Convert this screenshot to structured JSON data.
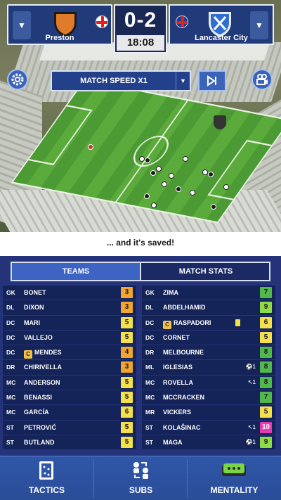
{
  "scoreboard": {
    "home_team": "Preston",
    "away_team": "Lancaster City",
    "score": "0-2",
    "clock": "18:08"
  },
  "controls": {
    "speed_label": "MATCH SPEED X1"
  },
  "commentary": "... and it's saved!",
  "tabs": {
    "teams": "TEAMS",
    "match_stats": "MATCH STATS"
  },
  "home_roster": [
    {
      "pos": "GK",
      "name": "BONET",
      "rating": "3"
    },
    {
      "pos": "DL",
      "name": "DIXON",
      "rating": "3"
    },
    {
      "pos": "DC",
      "name": "MARI",
      "rating": "5"
    },
    {
      "pos": "DC",
      "name": "VALLEJO",
      "rating": "5"
    },
    {
      "pos": "DC",
      "name": "MENDES",
      "rating": "4",
      "captain": "C"
    },
    {
      "pos": "DR",
      "name": "CHIRIVELLA",
      "rating": "3"
    },
    {
      "pos": "MC",
      "name": "ANDERSON",
      "rating": "5"
    },
    {
      "pos": "MC",
      "name": "BENASSI",
      "rating": "5"
    },
    {
      "pos": "MC",
      "name": "GARCÍA",
      "rating": "6"
    },
    {
      "pos": "ST",
      "name": "PETROVIĆ",
      "rating": "5"
    },
    {
      "pos": "ST",
      "name": "BUTLAND",
      "rating": "5"
    }
  ],
  "away_roster": [
    {
      "pos": "GK",
      "name": "ZIMA",
      "rating": "7"
    },
    {
      "pos": "DL",
      "name": "ABDELHAMID",
      "rating": "9"
    },
    {
      "pos": "DC",
      "name": "RASPADORI",
      "rating": "6",
      "captain": "C"
    },
    {
      "pos": "DC",
      "name": "CORNET",
      "rating": "5"
    },
    {
      "pos": "DR",
      "name": "MELBOURNE",
      "rating": "8"
    },
    {
      "pos": "ML",
      "name": "IGLESIAS",
      "rating": "8",
      "event": "⚽1"
    },
    {
      "pos": "MC",
      "name": "ROVELLA",
      "rating": "8",
      "event": "↖1"
    },
    {
      "pos": "MC",
      "name": "MCCRACKEN",
      "rating": "7"
    },
    {
      "pos": "MR",
      "name": "VICKERS",
      "rating": "5"
    },
    {
      "pos": "ST",
      "name": "KOLAŠINAC",
      "rating": "10",
      "event": "↖1"
    },
    {
      "pos": "ST",
      "name": "MAGA",
      "rating": "9",
      "event": "⚽1"
    }
  ],
  "navbar": {
    "tactics": "TACTICS",
    "subs": "SUBS",
    "mentality": "MENTALITY"
  },
  "icons": {
    "settings": "gear-icon",
    "camera": "camera-icon",
    "skip": "skip-forward-icon",
    "tactics": "tactics-board-icon",
    "subs": "substitution-icon",
    "mentality": "mentality-icon"
  },
  "colors": {
    "rating_3": "#f0a531",
    "rating_4": "#f0a531",
    "rating_5": "#f4e04d",
    "rating_6": "#f4e04d",
    "rating_7": "#51b84b",
    "rating_8": "#51b84b",
    "rating_9": "#8edb45",
    "rating_10": "#e63cb3"
  }
}
